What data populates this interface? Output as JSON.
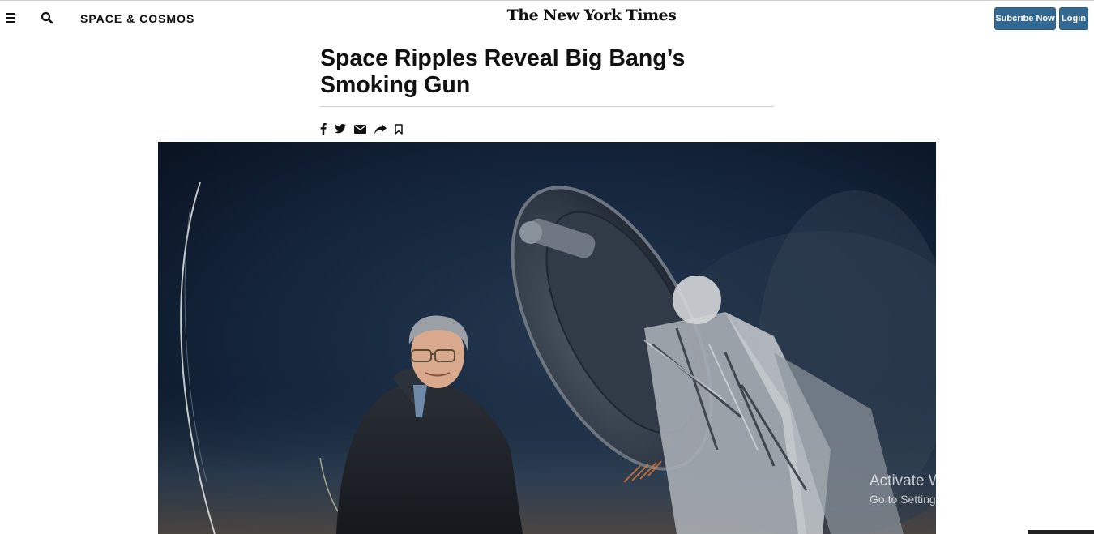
{
  "header": {
    "menu_icon": "hamburger-menu-icon",
    "search_icon": "search-icon",
    "section": "SPACE & COSMOS",
    "logo": "The New York Times",
    "subscribe_label": "Subcribe Now",
    "login_label": "Login"
  },
  "article": {
    "headline": "Space Ripples Reveal Big Bang’s Smoking Gun",
    "share_icons": [
      "facebook-icon",
      "twitter-icon",
      "email-icon",
      "share-icon",
      "bookmark-icon"
    ]
  },
  "photo": {
    "subject": "Person standing in front of a large radio telescope at night"
  },
  "watermark": {
    "title": "Activate Windows",
    "subtitle": "Go to Settings to activate Windows."
  },
  "colors": {
    "button_bg": "#326891",
    "text": "#111111",
    "photo_bg": "#0d1c2e"
  }
}
